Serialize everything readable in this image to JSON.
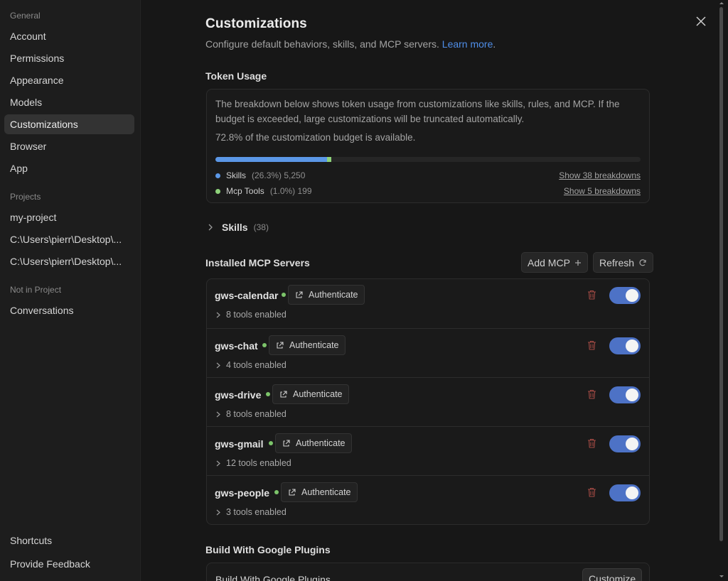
{
  "sidebar": {
    "general_label": "General",
    "general_items": [
      "Account",
      "Permissions",
      "Appearance",
      "Models",
      "Customizations",
      "Browser",
      "App"
    ],
    "projects_label": "Projects",
    "project_items": [
      "my-project",
      "C:\\Users\\pierr\\Desktop\\...",
      "C:\\Users\\pierr\\Desktop\\..."
    ],
    "not_in_project_label": "Not in Project",
    "not_in_project_items": [
      "Conversations"
    ],
    "footer_items": [
      "Shortcuts",
      "Provide Feedback"
    ],
    "active_item": "Customizations"
  },
  "page": {
    "title": "Customizations",
    "subtitle": "Configure default behaviors, skills, and MCP servers.",
    "learn_more": "Learn more",
    "after_link": "."
  },
  "token_usage": {
    "heading": "Token Usage",
    "description": "The breakdown below shows token usage from customizations like skills, rules, and MCP. If the budget is exceeded, large customizations will be truncated automatically.",
    "available_text": "72.8% of the customization budget is available.",
    "bar_skills_fraction": 0.263,
    "bar_mcp_fraction": 0.01,
    "legend": [
      {
        "name": "Skills",
        "meta": "(26.3%) 5,250",
        "link": "Show 38 breakdowns",
        "color": "#5b97e6"
      },
      {
        "name": "Mcp Tools",
        "meta": "(1.0%) 199",
        "link": "Show 5 breakdowns",
        "color": "#8ed27a"
      }
    ]
  },
  "skills": {
    "label": "Skills",
    "count": "(38)"
  },
  "mcp": {
    "heading": "Installed MCP Servers",
    "add_label": "Add MCP",
    "refresh_label": "Refresh",
    "auth_label": "Authenticate",
    "servers": [
      {
        "name": "gws-calendar",
        "tools": "8 tools enabled",
        "enabled": true,
        "status_color": "#7cc46a"
      },
      {
        "name": "gws-chat",
        "tools": "4 tools enabled",
        "enabled": true,
        "status_color": "#7cc46a"
      },
      {
        "name": "gws-drive",
        "tools": "8 tools enabled",
        "enabled": true,
        "status_color": "#7cc46a"
      },
      {
        "name": "gws-gmail",
        "tools": "12 tools enabled",
        "enabled": true,
        "status_color": "#7cc46a"
      },
      {
        "name": "gws-people",
        "tools": "3 tools enabled",
        "enabled": true,
        "status_color": "#7cc46a"
      }
    ]
  },
  "plugins": {
    "heading": "Build With Google Plugins",
    "row_label": "Build With Google Plugins",
    "customize_label": "Customize"
  }
}
